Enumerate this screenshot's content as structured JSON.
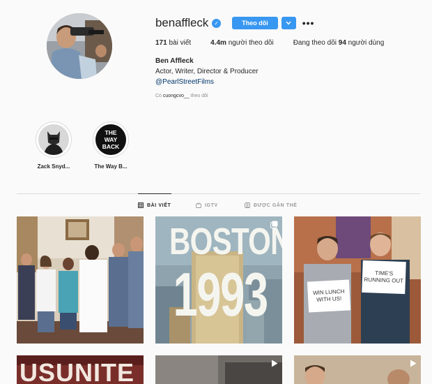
{
  "profile": {
    "username": "benaffleck",
    "follow_label": "Theo dõi",
    "stats": [
      {
        "value": "171",
        "label": "bài viết"
      },
      {
        "value": "4.4m",
        "label": "người theo dõi"
      }
    ],
    "following_prefix": "Đang theo dõi",
    "following_value": "94",
    "following_suffix": "người dùng",
    "full_name": "Ben Affleck",
    "bio": "Actor, Writer, Director & Producer",
    "link": "@PearlStreetFilms",
    "followed_by_prefix": "Có",
    "followed_by_user": "cuongcvo__",
    "followed_by_suffix": "theo dõi"
  },
  "highlights": [
    {
      "label": "Zack Snyd..."
    },
    {
      "label": "The Way B...",
      "cover_text": [
        "THE",
        "WAY",
        "BACK"
      ]
    }
  ],
  "tabs": [
    {
      "label": "BÀI VIẾT",
      "icon": "grid-icon",
      "active": true
    },
    {
      "label": "IGTV",
      "icon": "igtv-icon",
      "active": false
    },
    {
      "label": "ĐƯỢC GẮN THẺ",
      "icon": "tagged-icon",
      "active": false
    }
  ],
  "posts": [
    {
      "kind": "photo"
    },
    {
      "kind": "carousel",
      "text_line1": "BOSTON",
      "text_line2": "1993"
    },
    {
      "kind": "photo",
      "sign_left": [
        "WIN LUNCH",
        "WITH US!"
      ],
      "sign_right": [
        "TIME'S",
        "RUNNING OUT"
      ]
    },
    {
      "kind": "photo",
      "text": "USUNITE"
    },
    {
      "kind": "video"
    },
    {
      "kind": "video"
    }
  ],
  "colors": {
    "accent": "#3897f0",
    "text": "#262626",
    "muted": "#8e8e8e",
    "link": "#003569",
    "background": "#fafafa"
  }
}
